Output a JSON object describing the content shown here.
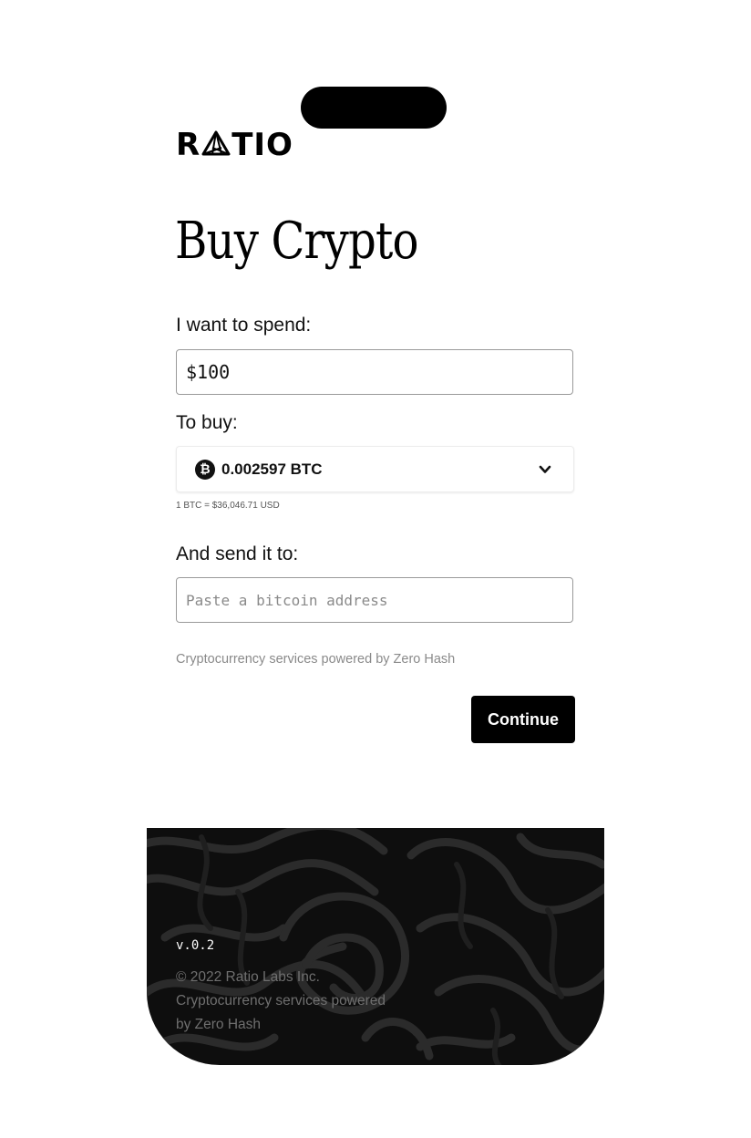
{
  "brand": {
    "logo_text_left": "R",
    "logo_text_right": "TIO"
  },
  "page_title": "Buy Crypto",
  "spend": {
    "label": "I want to spend:",
    "value": "$100"
  },
  "buy": {
    "label": "To buy:",
    "selected_value": "0.002597 BTC",
    "icon": "bitcoin-icon",
    "rate": "1 BTC = $36,046.71 USD"
  },
  "send": {
    "label": "And send it to:",
    "placeholder": "Paste a bitcoin address"
  },
  "powered_by": "Cryptocurrency services powered by Zero Hash",
  "continue_label": "Continue",
  "footer": {
    "version": "v.0.2",
    "copyright": "© 2022 Ratio Labs Inc.",
    "powered_line1": "Cryptocurrency services powered",
    "powered_line2": "by Zero Hash"
  },
  "colors": {
    "primary": "#000000",
    "placeholder": "#8a8a8a",
    "footer_bg": "#0e0e0e"
  }
}
